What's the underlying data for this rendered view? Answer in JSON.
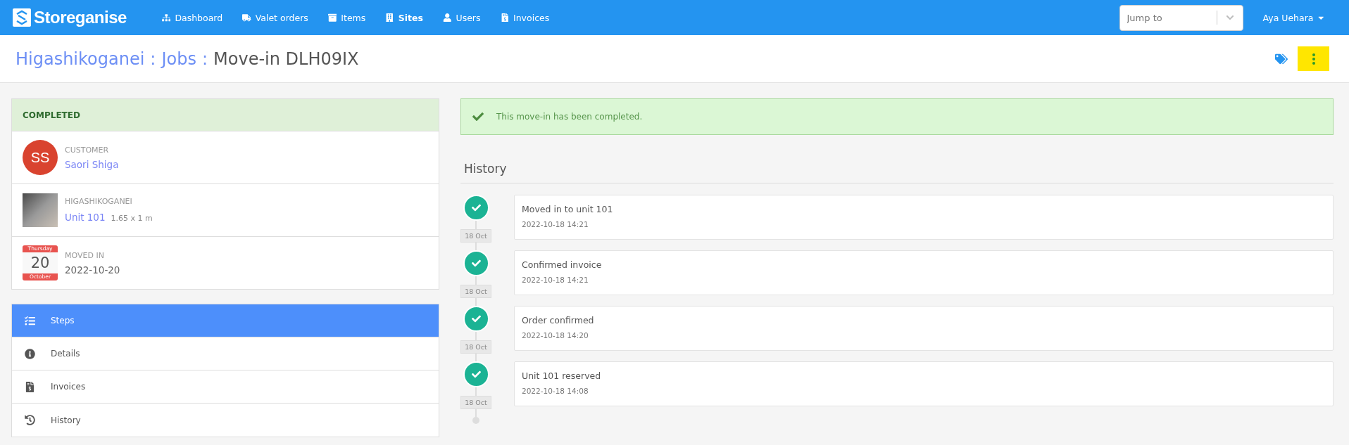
{
  "navbar": {
    "brand": "Storeganise",
    "items": [
      {
        "label": "Dashboard",
        "selected": false
      },
      {
        "label": "Valet orders",
        "selected": false
      },
      {
        "label": "Items",
        "selected": false
      },
      {
        "label": "Sites",
        "selected": true
      },
      {
        "label": "Users",
        "selected": false
      },
      {
        "label": "Invoices",
        "selected": false
      }
    ],
    "jump": {
      "placeholder": "Jump to"
    },
    "user": "Aya Uehara"
  },
  "breadcrumb": [
    {
      "label": "Higashikoganei",
      "kind": "link"
    },
    {
      "label": "Jobs",
      "kind": "link",
      "separator": ":"
    },
    {
      "label": "Move-in DLH09IX",
      "kind": "current",
      "separator": ":"
    }
  ],
  "status": {
    "label": "COMPLETED",
    "customer": {
      "caption": "CUSTOMER",
      "initials": "SS",
      "name": "Saori Shiga"
    },
    "site": {
      "caption": "HIGASHIKOGANEI",
      "unit": "Unit 101",
      "size": "1.65 x 1 m"
    },
    "moved": {
      "caption": "MOVED IN",
      "weekday": "Thursday",
      "day": "20",
      "month": "October",
      "date": "2022-10-20"
    }
  },
  "menu": [
    {
      "label": "Steps",
      "selected": true
    },
    {
      "label": "Details",
      "selected": false
    },
    {
      "label": "Invoices",
      "selected": false
    },
    {
      "label": "History",
      "selected": false
    }
  ],
  "alert": "This move-in has been completed.",
  "history": {
    "title": "History",
    "events": [
      {
        "title": "Moved in to unit 101",
        "time": "2022-10-18 14:21",
        "date": "18 Oct"
      },
      {
        "title": "Confirmed invoice",
        "time": "2022-10-18 14:21",
        "date": "18 Oct"
      },
      {
        "title": "Order confirmed",
        "time": "2022-10-18 14:20",
        "date": "18 Oct"
      },
      {
        "title": "Unit 101 reserved",
        "time": "2022-10-18 14:08",
        "date": "18 Oct"
      }
    ]
  }
}
